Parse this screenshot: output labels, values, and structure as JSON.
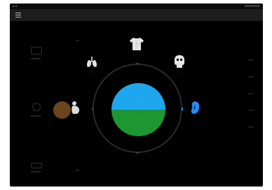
{
  "app": {
    "center": {
      "top_label": "···",
      "bottom_label": "·······"
    },
    "organs": [
      {
        "name": "torso",
        "label": "········"
      },
      {
        "name": "lungs",
        "label": "····"
      },
      {
        "name": "brain",
        "label": "·····"
      },
      {
        "name": "baby",
        "label": "········"
      },
      {
        "name": "kidney",
        "label": "······"
      }
    ],
    "colors": {
      "background": "#000000",
      "top_half": "#1ea6ee",
      "bottom_half": "#1d9732",
      "accent": "#1e90ff",
      "ring": "#2a2a2a"
    },
    "icons": [
      "menu-icon",
      "torso-icon",
      "lungs-icon",
      "brain-icon",
      "baby-icon",
      "kidney-icon"
    ]
  }
}
